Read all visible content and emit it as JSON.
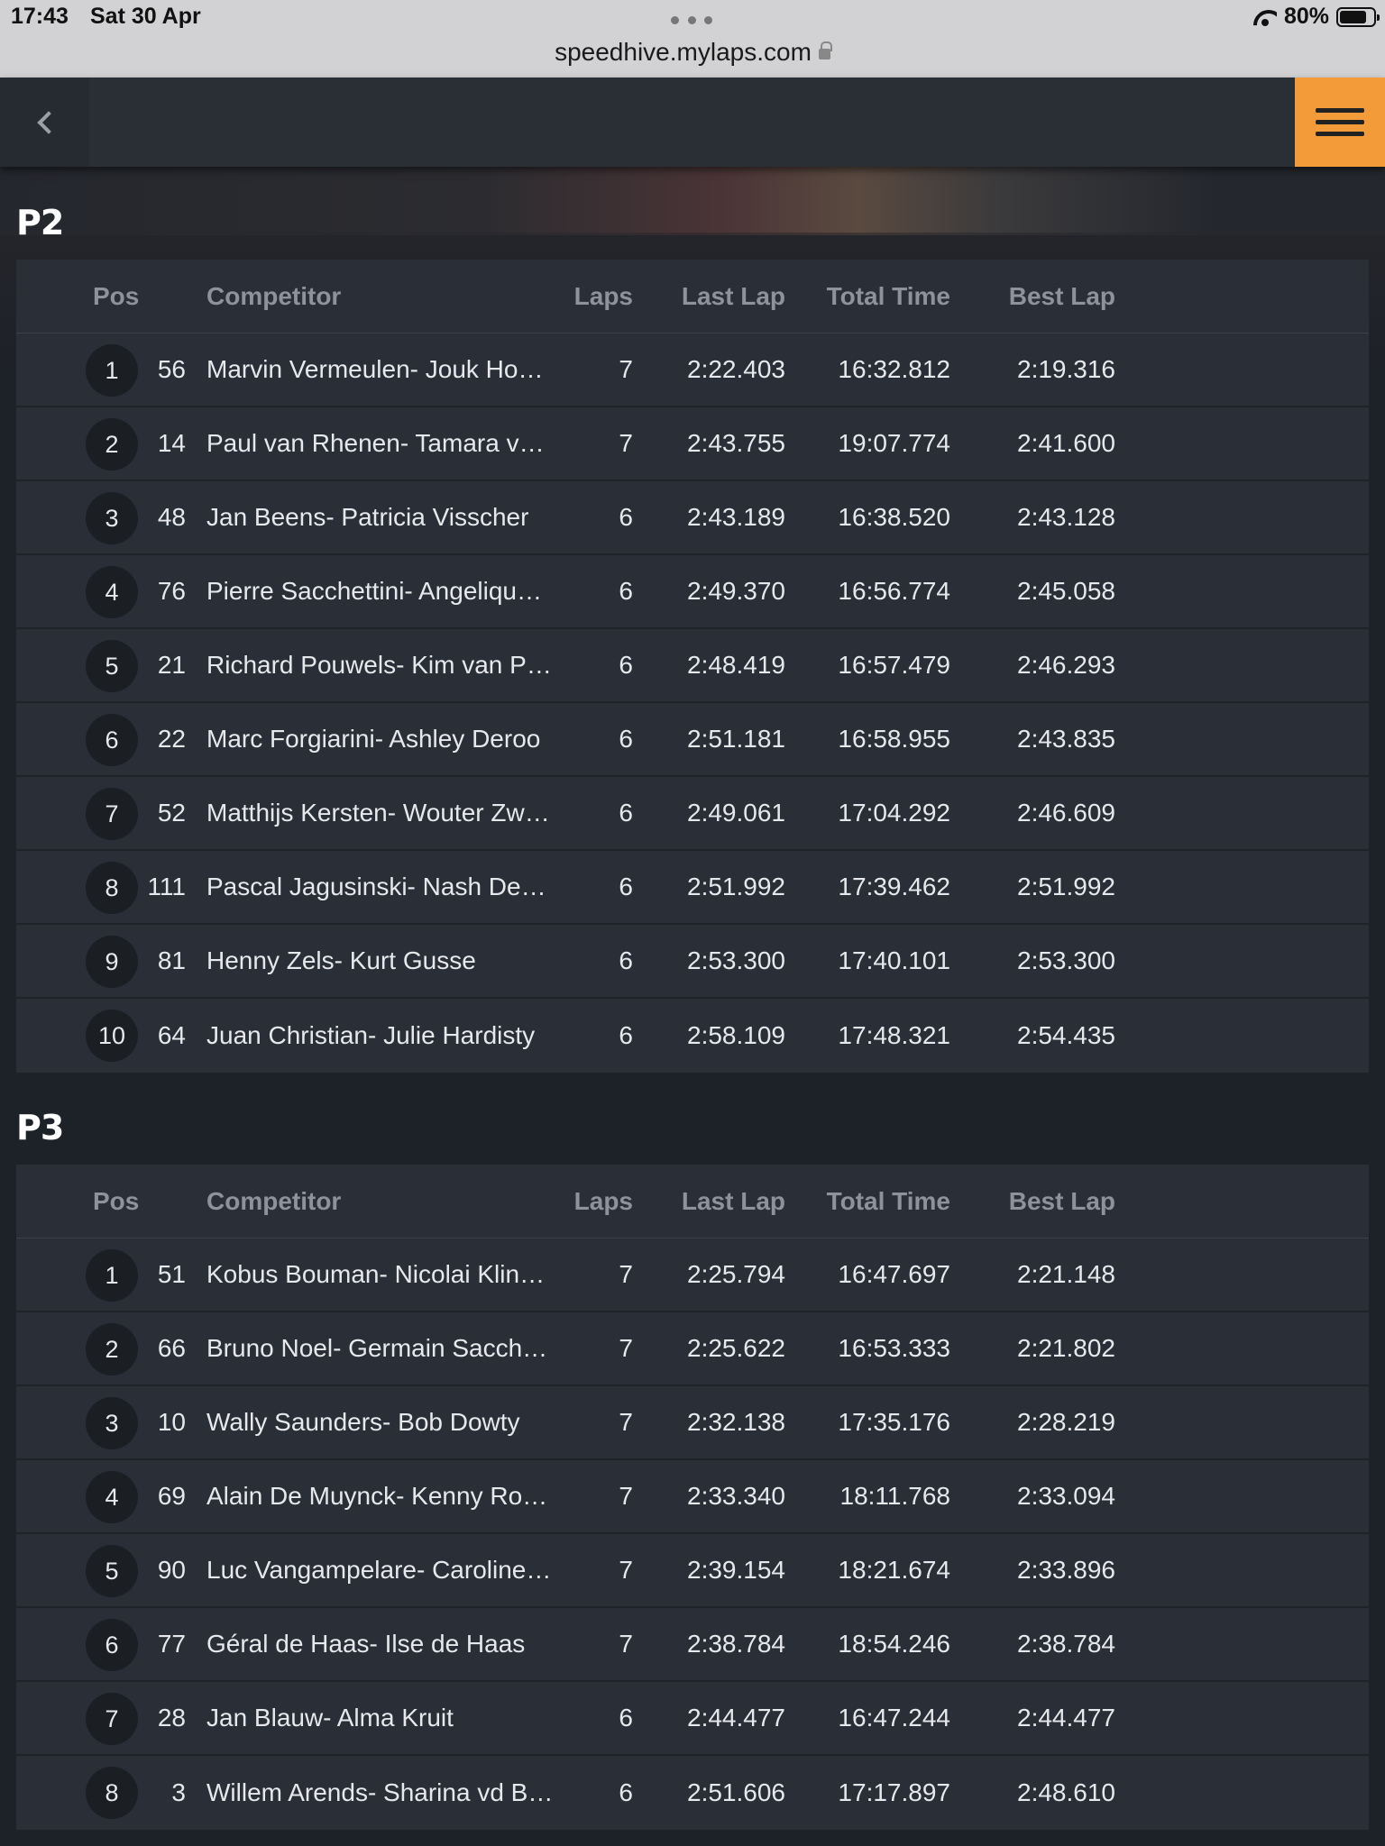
{
  "status_bar": {
    "time": "17:43",
    "date": "Sat 30 Apr",
    "url": "speedhive.mylaps.com",
    "battery": "80%",
    "battery_level": 0.8
  },
  "app": {
    "back_icon": "chevron-left-icon",
    "menu_icon": "hamburger-menu-icon",
    "accent_color": "#f29b38"
  },
  "columns": {
    "pos": "Pos",
    "competitor": "Competitor",
    "laps": "Laps",
    "last_lap": "Last Lap",
    "total_time": "Total Time",
    "best_lap": "Best Lap"
  },
  "sections": [
    {
      "title": "P2",
      "rows": [
        {
          "pos": "1",
          "num": "56",
          "name": "Marvin Vermeulen- Jouk Hoekstra",
          "laps": "7",
          "last": "2:22.403",
          "total": "16:32.812",
          "best": "2:19.316"
        },
        {
          "pos": "2",
          "num": "14",
          "name": "Paul van Rhenen- Tamara van Rhenen",
          "laps": "7",
          "last": "2:43.755",
          "total": "19:07.774",
          "best": "2:41.600"
        },
        {
          "pos": "3",
          "num": "48",
          "name": "Jan Beens- Patricia Visscher",
          "laps": "6",
          "last": "2:43.189",
          "total": "16:38.520",
          "best": "2:43.128"
        },
        {
          "pos": "4",
          "num": "76",
          "name": "Pierre Sacchettini- Angelique Sacchettini",
          "laps": "6",
          "last": "2:49.370",
          "total": "16:56.774",
          "best": "2:45.058"
        },
        {
          "pos": "5",
          "num": "21",
          "name": "Richard Pouwels- Kim van Pouwels",
          "laps": "6",
          "last": "2:48.419",
          "total": "16:57.479",
          "best": "2:46.293"
        },
        {
          "pos": "6",
          "num": "22",
          "name": "Marc Forgiarini- Ashley Deroo",
          "laps": "6",
          "last": "2:51.181",
          "total": "16:58.955",
          "best": "2:43.835"
        },
        {
          "pos": "7",
          "num": "52",
          "name": "Matthijs Kersten- Wouter Zwanenburg",
          "laps": "6",
          "last": "2:49.061",
          "total": "17:04.292",
          "best": "2:46.609"
        },
        {
          "pos": "8",
          "num": "111",
          "name": "Pascal Jagusinski- Nash Deprez",
          "laps": "6",
          "last": "2:51.992",
          "total": "17:39.462",
          "best": "2:51.992"
        },
        {
          "pos": "9",
          "num": "81",
          "name": "Henny Zels- Kurt Gusse",
          "laps": "6",
          "last": "2:53.300",
          "total": "17:40.101",
          "best": "2:53.300"
        },
        {
          "pos": "10",
          "num": "64",
          "name": "Juan Christian- Julie Hardisty",
          "laps": "6",
          "last": "2:58.109",
          "total": "17:48.321",
          "best": "2:54.435"
        }
      ]
    },
    {
      "title": "P3",
      "rows": [
        {
          "pos": "1",
          "num": "51",
          "name": "Kobus Bouman- Nicolai Klinkhamer",
          "laps": "7",
          "last": "2:25.794",
          "total": "16:47.697",
          "best": "2:21.148"
        },
        {
          "pos": "2",
          "num": "66",
          "name": "Bruno Noel- Germain Sacchettini",
          "laps": "7",
          "last": "2:25.622",
          "total": "16:53.333",
          "best": "2:21.802"
        },
        {
          "pos": "3",
          "num": "10",
          "name": "Wally Saunders- Bob Dowty",
          "laps": "7",
          "last": "2:32.138",
          "total": "17:35.176",
          "best": "2:28.219"
        },
        {
          "pos": "4",
          "num": "69",
          "name": "Alain De Muynck- Kenny Roose",
          "laps": "7",
          "last": "2:33.340",
          "total": "18:11.768",
          "best": "2:33.094"
        },
        {
          "pos": "5",
          "num": "90",
          "name": "Luc Vangampelare- Caroline Vangampelare",
          "laps": "7",
          "last": "2:39.154",
          "total": "18:21.674",
          "best": "2:33.896"
        },
        {
          "pos": "6",
          "num": "77",
          "name": "Géral de Haas- Ilse de Haas",
          "laps": "7",
          "last": "2:38.784",
          "total": "18:54.246",
          "best": "2:38.784"
        },
        {
          "pos": "7",
          "num": "28",
          "name": "Jan Blauw- Alma Kruit",
          "laps": "6",
          "last": "2:44.477",
          "total": "16:47.244",
          "best": "2:44.477"
        },
        {
          "pos": "8",
          "num": "3",
          "name": "Willem Arends- Sharina vd Berg",
          "laps": "6",
          "last": "2:51.606",
          "total": "17:17.897",
          "best": "2:48.610"
        }
      ]
    }
  ]
}
